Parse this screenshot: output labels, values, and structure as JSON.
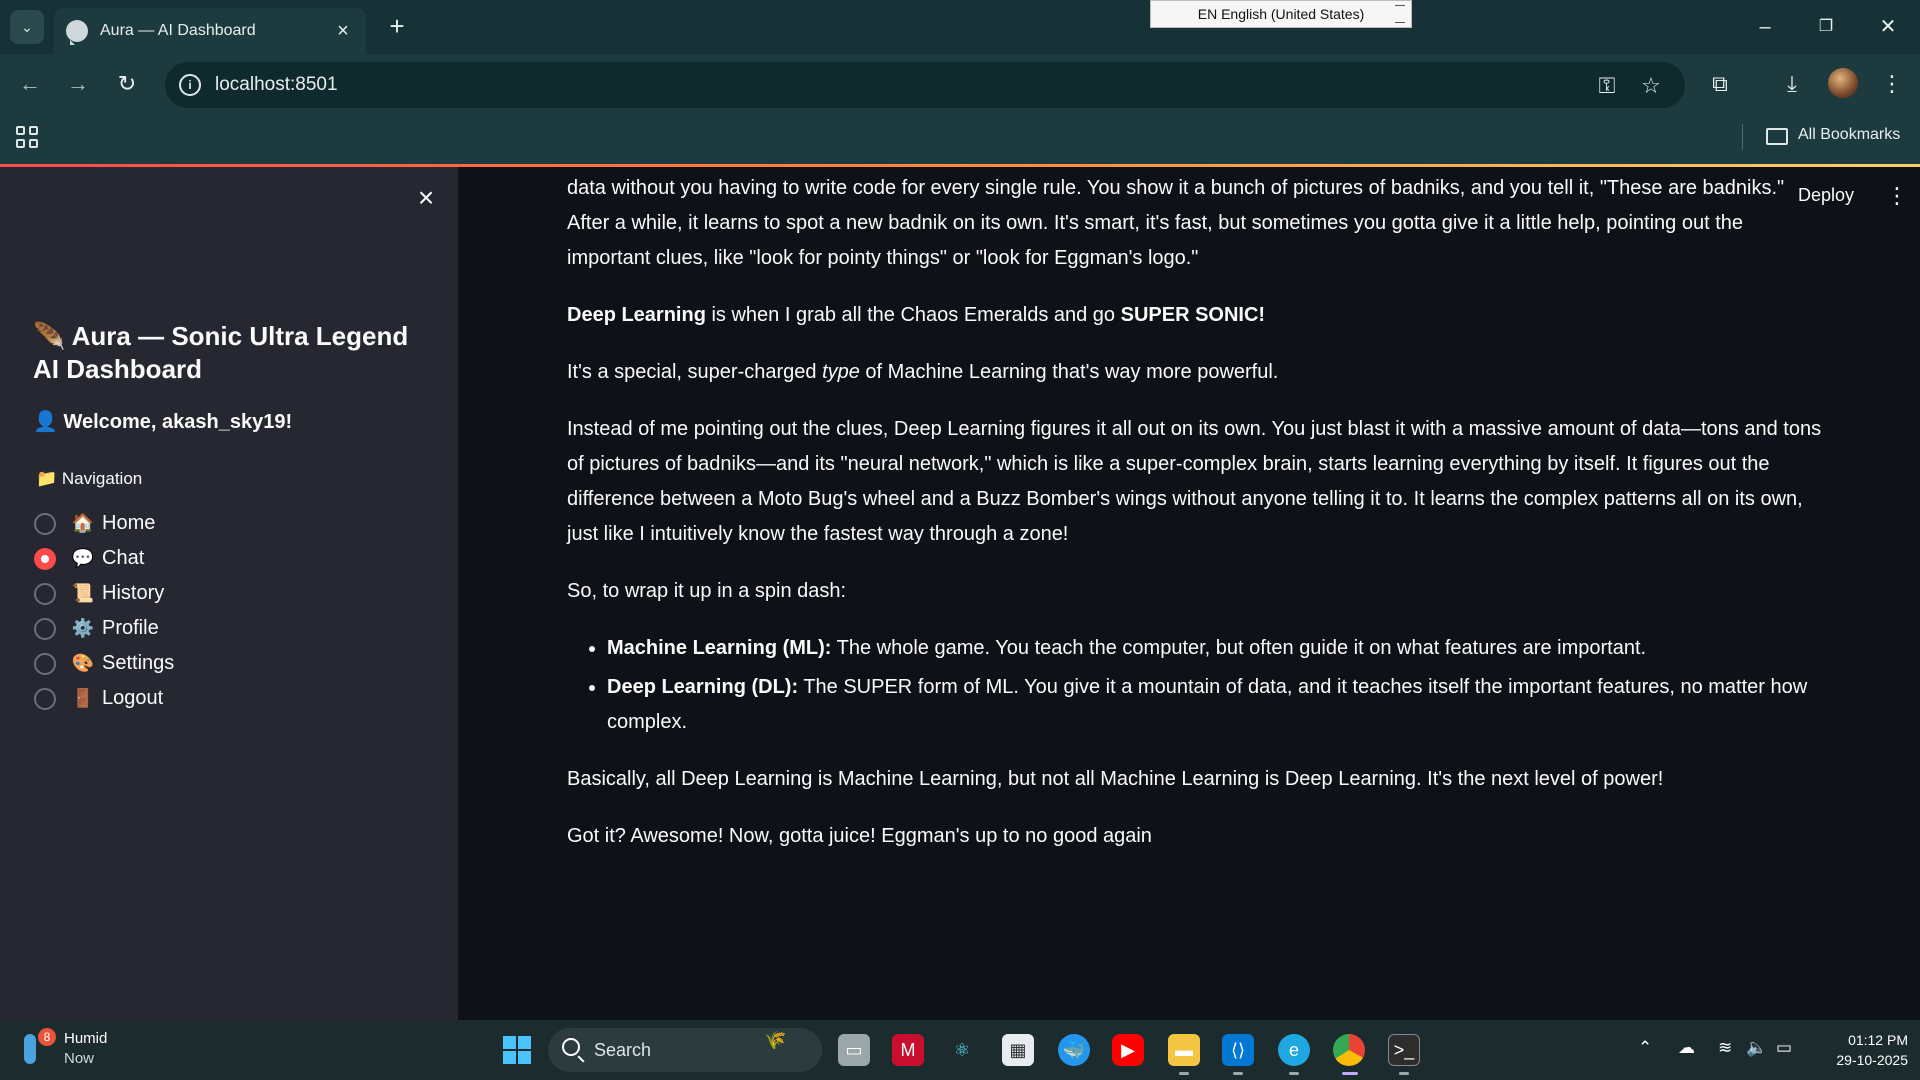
{
  "browser": {
    "tab_title": "Aura — AI Dashboard",
    "url": "localhost:8501",
    "language_indicator": "EN English (United States)",
    "bookmarks_label": "All Bookmarks"
  },
  "app": {
    "deploy_label": "Deploy",
    "sidebar": {
      "title_icon": "🪶",
      "title": "Aura — Sonic Ultra Legend AI Dashboard",
      "welcome_icon": "👤",
      "welcome": "Welcome, akash_sky19!",
      "nav_icon": "📁",
      "nav_label": "Navigation",
      "selected": "Chat",
      "items": [
        {
          "icon": "🏠",
          "label": "Home"
        },
        {
          "icon": "💬",
          "label": "Chat"
        },
        {
          "icon": "📜",
          "label": "History"
        },
        {
          "icon": "⚙️",
          "label": "Profile"
        },
        {
          "icon": "🎨",
          "label": "Settings"
        },
        {
          "icon": "🚪",
          "label": "Logout"
        }
      ]
    },
    "message": {
      "p1_cut": "data without you having to write code for every single rule. You show it a bunch of pictures of badniks, and you tell it, \"These are badniks.\" After a while, it learns to spot a new badnik on its own. It's smart, it's fast, but sometimes you gotta give it a little help, pointing out the important clues, like \"look for pointy things\" or \"look for Eggman's logo.\"",
      "p2_b1": "Deep Learning",
      "p2_t1": " is when I grab all the Chaos Emeralds and go ",
      "p2_b2": "SUPER SONIC!",
      "p3_t1": "It's a special, super-charged ",
      "p3_i1": "type",
      "p3_t2": " of Machine Learning that's way more powerful.",
      "p4": "Instead of me pointing out the clues, Deep Learning figures it all out on its own. You just blast it with a massive amount of data—tons and tons of pictures of badniks—and its \"neural network,\" which is like a super-complex brain, starts learning everything by itself. It figures out the difference between a Moto Bug's wheel and a Buzz Bomber's wings without anyone telling it to. It learns the complex patterns all on its own, just like I intuitively know the fastest way through a zone!",
      "p5": "So, to wrap it up in a spin dash:",
      "bullets": [
        {
          "bold": "Machine Learning (ML):",
          "text": " The whole game. You teach the computer, but often guide it on what features are important."
        },
        {
          "bold": "Deep Learning (DL):",
          "text": " The SUPER form of ML. You give it a mountain of data, and it teaches itself the important features, no matter how complex."
        }
      ],
      "p6": "Basically, all Deep Learning is Machine Learning, but not all Machine Learning is Deep Learning. It's the next level of power!",
      "p7": "Got it? Awesome! Now, gotta juice! Eggman's up to no good again"
    }
  },
  "taskbar": {
    "weather_title": "Humid",
    "weather_sub": "Now",
    "weather_badge": "8",
    "search_label": "Search",
    "time": "01:12 PM",
    "date": "29-10-2025"
  },
  "colors": {
    "accent": "#ff4b4b",
    "sidebar_bg": "#262730",
    "main_bg": "#0e1117",
    "chrome_bg": "#1d3b3e"
  }
}
